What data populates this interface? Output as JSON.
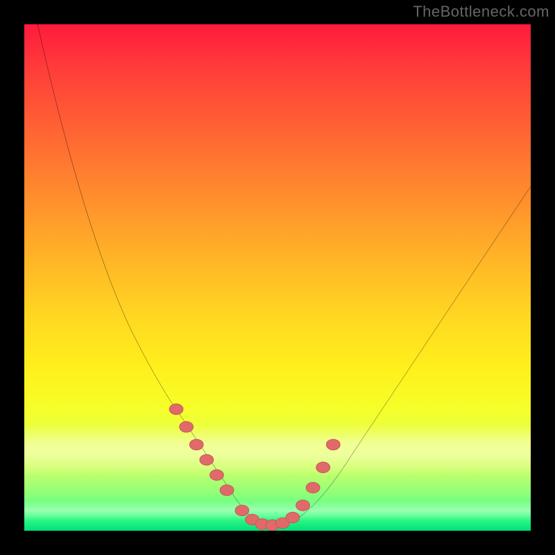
{
  "watermark": "TheBottleneck.com",
  "colors": {
    "background": "#000000",
    "watermark": "#666666",
    "curve": "#000000",
    "marker_fill": "#e06a6a",
    "marker_stroke": "#c85a5a",
    "gradient_top": "#ff1a3c",
    "gradient_bottom": "#00e07a"
  },
  "chart_data": {
    "type": "line",
    "title": "",
    "xlabel": "",
    "ylabel": "",
    "xlim": [
      0,
      100
    ],
    "ylim": [
      0,
      100
    ],
    "grid": false,
    "legend": false,
    "series": [
      {
        "name": "curve",
        "x": [
          0,
          4,
          8,
          12,
          16,
          20,
          24,
          28,
          32,
          36,
          38,
          40,
          42,
          44,
          46,
          48,
          50,
          54,
          58,
          62,
          66,
          70,
          74,
          78,
          82,
          86,
          90,
          94,
          98,
          100
        ],
        "y": [
          112,
          94,
          78,
          64,
          52,
          42,
          34,
          27,
          21,
          15,
          12,
          9,
          6,
          3.5,
          2,
          1.2,
          1,
          2.5,
          6,
          11,
          17,
          23,
          29,
          35,
          41,
          47,
          53,
          59,
          65,
          68
        ]
      }
    ],
    "markers": {
      "name": "highlight-points",
      "x": [
        30,
        32,
        34,
        36,
        38,
        40,
        43,
        45,
        47,
        49,
        51,
        53,
        55,
        57,
        59,
        61
      ],
      "y": [
        24,
        20.5,
        17,
        14,
        11,
        8,
        4,
        2.2,
        1.3,
        1.1,
        1.5,
        2.6,
        5,
        8.5,
        12.5,
        17
      ]
    }
  }
}
